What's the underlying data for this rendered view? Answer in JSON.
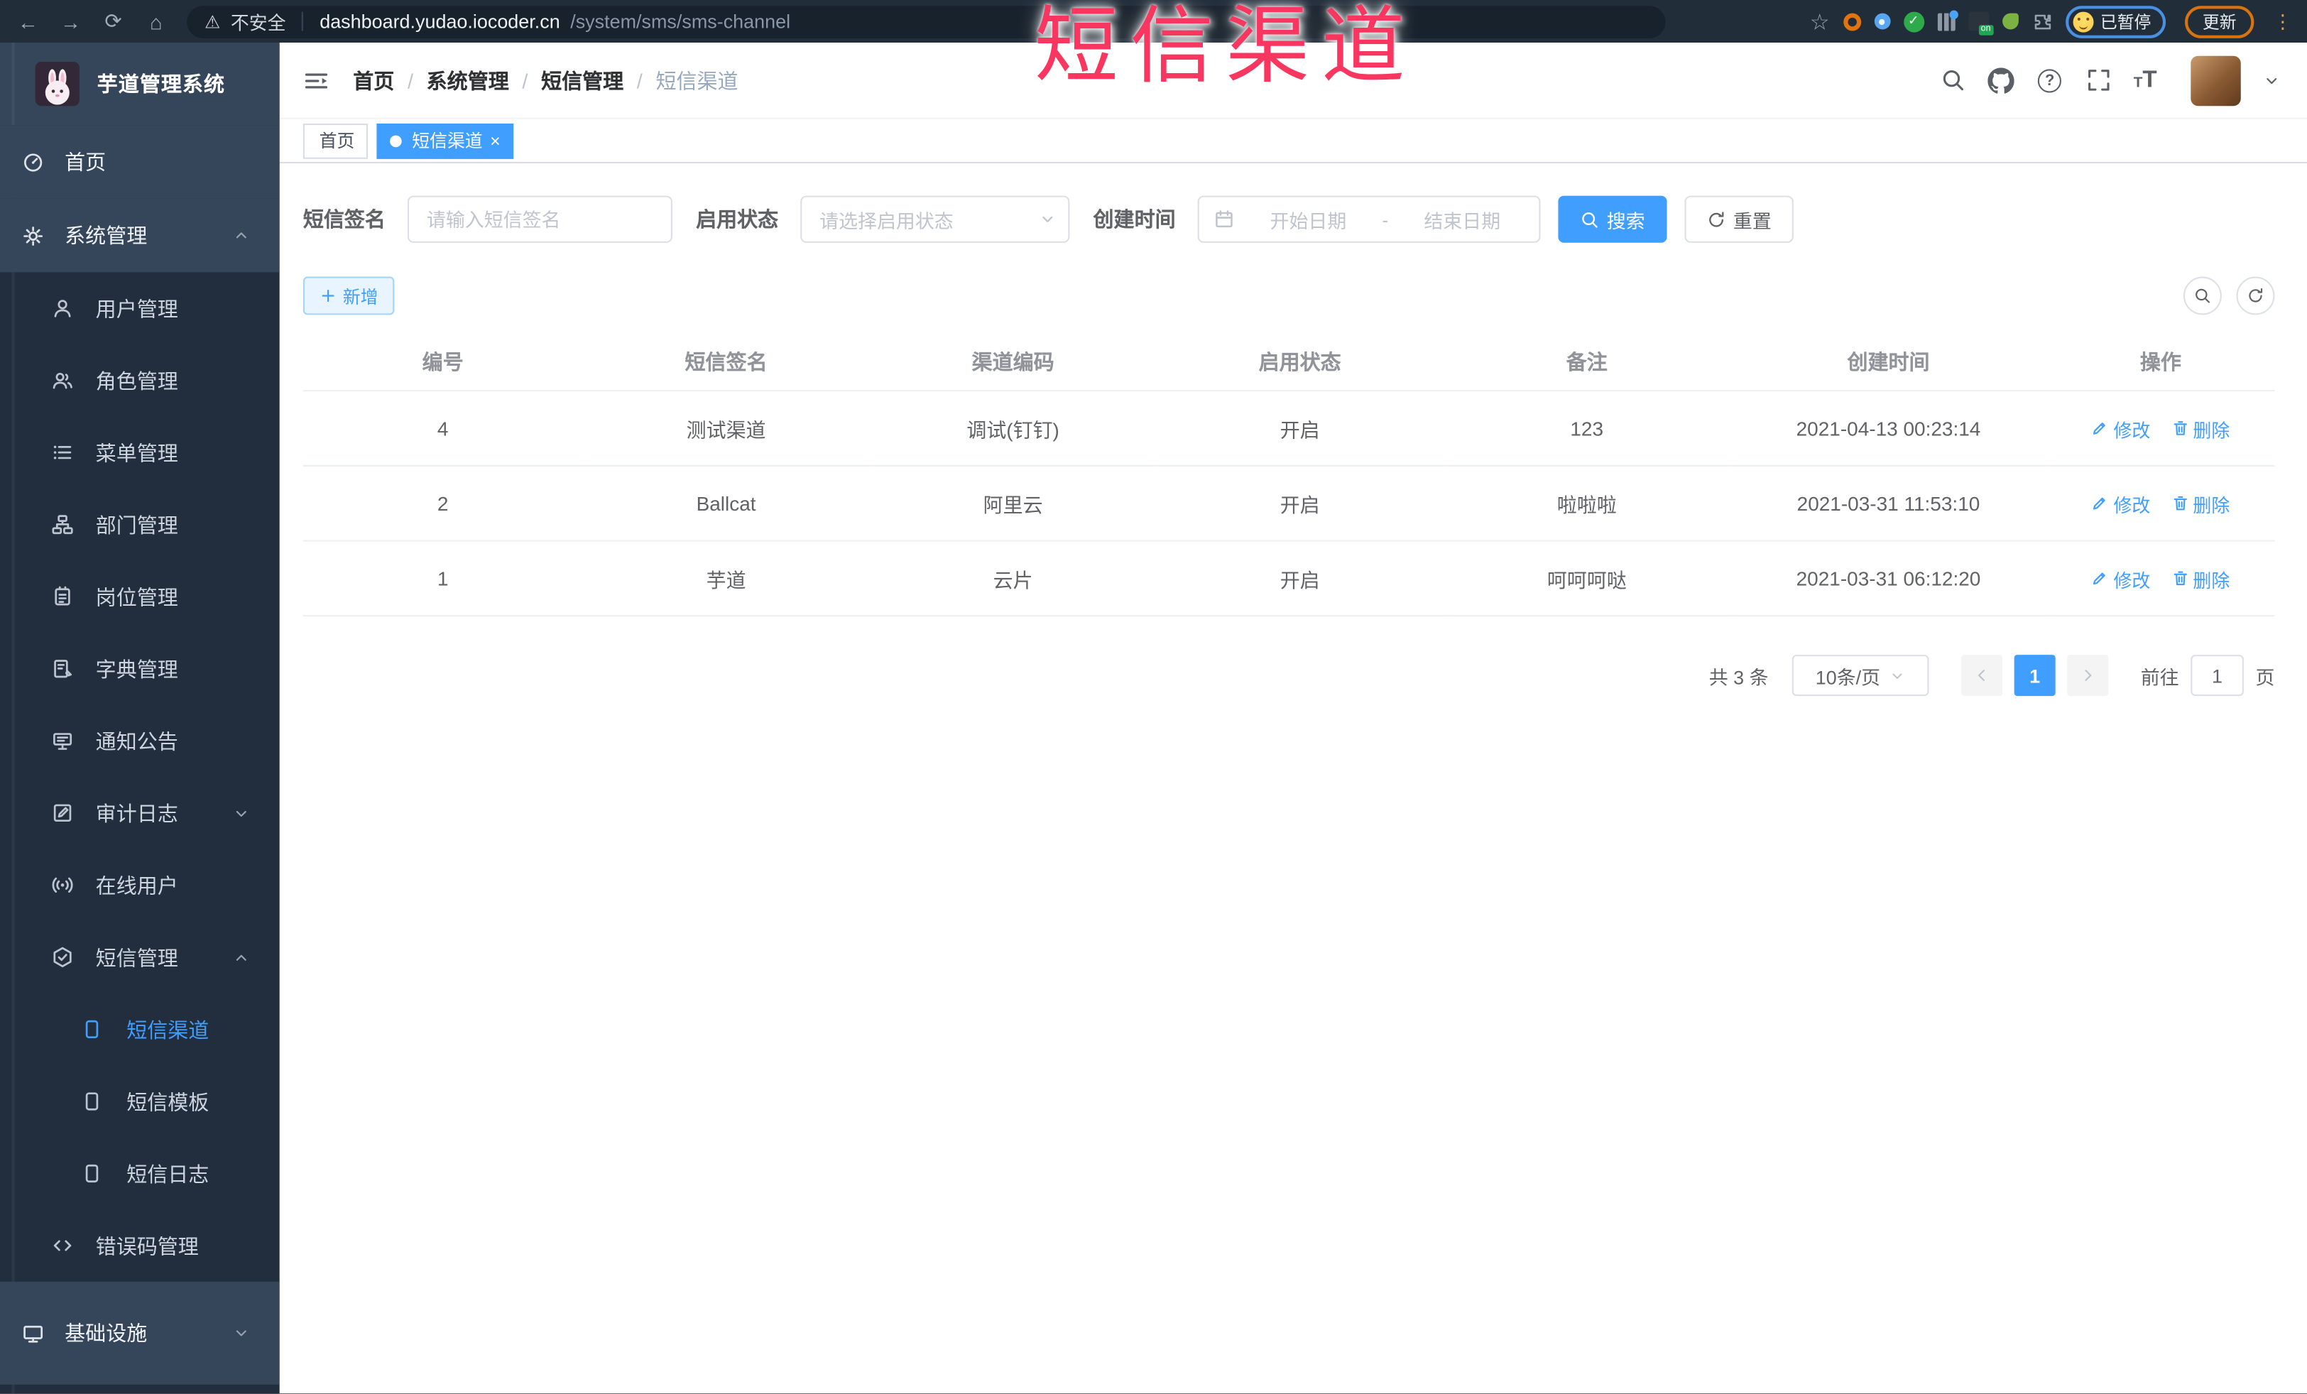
{
  "browser": {
    "security_label": "不安全",
    "url_host": "dashboard.yudao.iocoder.cn",
    "url_path": "/system/sms/sms-channel",
    "paused_label": "已暂停",
    "update_label": "更新",
    "extension_on_badge": "on"
  },
  "stamp_text": "短信渠道",
  "sidebar": {
    "logo_title": "芋道管理系统",
    "items": [
      {
        "label": "首页",
        "icon": "dashboard",
        "level": 1,
        "section": "top"
      },
      {
        "label": "系统管理",
        "icon": "gear",
        "level": 1,
        "caret": "up",
        "section": "top"
      },
      {
        "label": "用户管理",
        "icon": "user",
        "level": 2
      },
      {
        "label": "角色管理",
        "icon": "users",
        "level": 2
      },
      {
        "label": "菜单管理",
        "icon": "menu-list",
        "level": 2
      },
      {
        "label": "部门管理",
        "icon": "org-tree",
        "level": 2
      },
      {
        "label": "岗位管理",
        "icon": "badge",
        "level": 2
      },
      {
        "label": "字典管理",
        "icon": "dictionary",
        "level": 2
      },
      {
        "label": "通知公告",
        "icon": "announcement",
        "level": 2
      },
      {
        "label": "审计日志",
        "icon": "audit-log",
        "level": 2,
        "caret": "down"
      },
      {
        "label": "在线用户",
        "icon": "online-users",
        "level": 2
      },
      {
        "label": "短信管理",
        "icon": "sms-shield",
        "level": 2,
        "caret": "up"
      },
      {
        "label": "短信渠道",
        "icon": "phone-doc",
        "level": 3,
        "active": true
      },
      {
        "label": "短信模板",
        "icon": "phone-doc",
        "level": 3
      },
      {
        "label": "短信日志",
        "icon": "phone-doc",
        "level": 3
      },
      {
        "label": "错误码管理",
        "icon": "code",
        "level": 2
      },
      {
        "label": "基础设施",
        "icon": "monitor",
        "level": 1,
        "caret": "down",
        "section": "bottom"
      }
    ]
  },
  "header": {
    "breadcrumb": [
      "首页",
      "系统管理",
      "短信管理",
      "短信渠道"
    ]
  },
  "tabs": [
    {
      "label": "首页",
      "active": false
    },
    {
      "label": "短信渠道",
      "active": true,
      "closable": true
    }
  ],
  "filters": {
    "sign_label": "短信签名",
    "sign_placeholder": "请输入短信签名",
    "status_label": "启用状态",
    "status_placeholder": "请选择启用状态",
    "time_label": "创建时间",
    "date_start_placeholder": "开始日期",
    "date_separator": "-",
    "date_end_placeholder": "结束日期",
    "search_label": "搜索",
    "reset_label": "重置"
  },
  "toolbar": {
    "add_label": "新增"
  },
  "table": {
    "headers": [
      "编号",
      "短信签名",
      "渠道编码",
      "启用状态",
      "备注",
      "创建时间",
      "操作"
    ],
    "rows": [
      {
        "id": "4",
        "signature": "测试渠道",
        "channel_code": "调试(钉钉)",
        "status": "开启",
        "remark": "123",
        "create_time": "2021-04-13 00:23:14"
      },
      {
        "id": "2",
        "signature": "Ballcat",
        "channel_code": "阿里云",
        "status": "开启",
        "remark": "啦啦啦",
        "create_time": "2021-03-31 11:53:10"
      },
      {
        "id": "1",
        "signature": "芋道",
        "channel_code": "云片",
        "status": "开启",
        "remark": "呵呵呵哒",
        "create_time": "2021-03-31 06:12:20"
      }
    ],
    "edit_label": "修改",
    "delete_label": "删除"
  },
  "pagination": {
    "total_label": "共 3 条",
    "page_size_label": "10条/页",
    "current_page": "1",
    "goto_label": "前往",
    "goto_value": "1",
    "page_unit_label": "页"
  },
  "colors": {
    "accent": "#409eff",
    "stamp": "#f8365f",
    "sidebar_bg": "#222e3e",
    "sidebar_light_bg": "#35455a"
  },
  "icons_unicode": {
    "back": "←",
    "forward": "→",
    "reload": "⟳",
    "home": "⌂",
    "star": "☆",
    "warning": "⚠",
    "check": "✓",
    "more": "⋮"
  }
}
